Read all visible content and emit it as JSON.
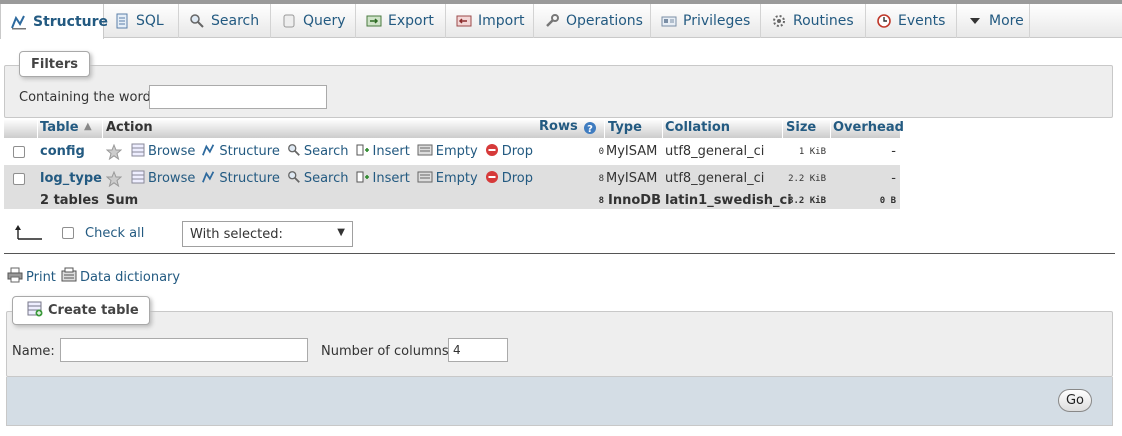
{
  "tabs": [
    {
      "label": "Structure",
      "icon": "structure-icon",
      "active": true
    },
    {
      "label": "SQL",
      "icon": "sql-icon"
    },
    {
      "label": "Search",
      "icon": "search-icon"
    },
    {
      "label": "Query",
      "icon": "query-icon"
    },
    {
      "label": "Export",
      "icon": "export-icon"
    },
    {
      "label": "Import",
      "icon": "import-icon"
    },
    {
      "label": "Operations",
      "icon": "wrench-icon"
    },
    {
      "label": "Privileges",
      "icon": "privileges-icon"
    },
    {
      "label": "Routines",
      "icon": "routines-icon"
    },
    {
      "label": "Events",
      "icon": "clock-icon"
    },
    {
      "label": "More",
      "icon": "chevron-down-icon"
    }
  ],
  "filters": {
    "legend": "Filters",
    "label": "Containing the word:",
    "value": ""
  },
  "table": {
    "headers": {
      "table": "Table",
      "action": "Action",
      "rows": "Rows",
      "type": "Type",
      "collation": "Collation",
      "size": "Size",
      "overhead": "Overhead"
    },
    "action_labels": {
      "browse": "Browse",
      "structure": "Structure",
      "search": "Search",
      "insert": "Insert",
      "empty": "Empty",
      "drop": "Drop"
    },
    "rows": [
      {
        "name": "config",
        "rows": "0",
        "type": "MyISAM",
        "collation": "utf8_general_ci",
        "size": "1 KiB",
        "overhead": "-"
      },
      {
        "name": "log_type",
        "rows": "8",
        "type": "MyISAM",
        "collation": "utf8_general_ci",
        "size": "2.2 KiB",
        "overhead": "-"
      }
    ],
    "summary": {
      "name": "2 tables",
      "action": "Sum",
      "rows": "8",
      "type": "InnoDB",
      "collation": "latin1_swedish_ci",
      "size": "3.2 KiB",
      "overhead": "0 B"
    }
  },
  "bulk": {
    "check_all": "Check all",
    "with_selected": "With selected:"
  },
  "links": {
    "print": "Print",
    "data_dictionary": "Data dictionary"
  },
  "create_table": {
    "legend": "Create table",
    "name_label": "Name:",
    "name_value": "",
    "columns_label": "Number of columns:",
    "columns_value": "4",
    "go": "Go"
  },
  "colors": {
    "link": "#235a81",
    "drop": "#d63a3a",
    "panel": "#eeeeee",
    "footer": "#d4dde5"
  }
}
